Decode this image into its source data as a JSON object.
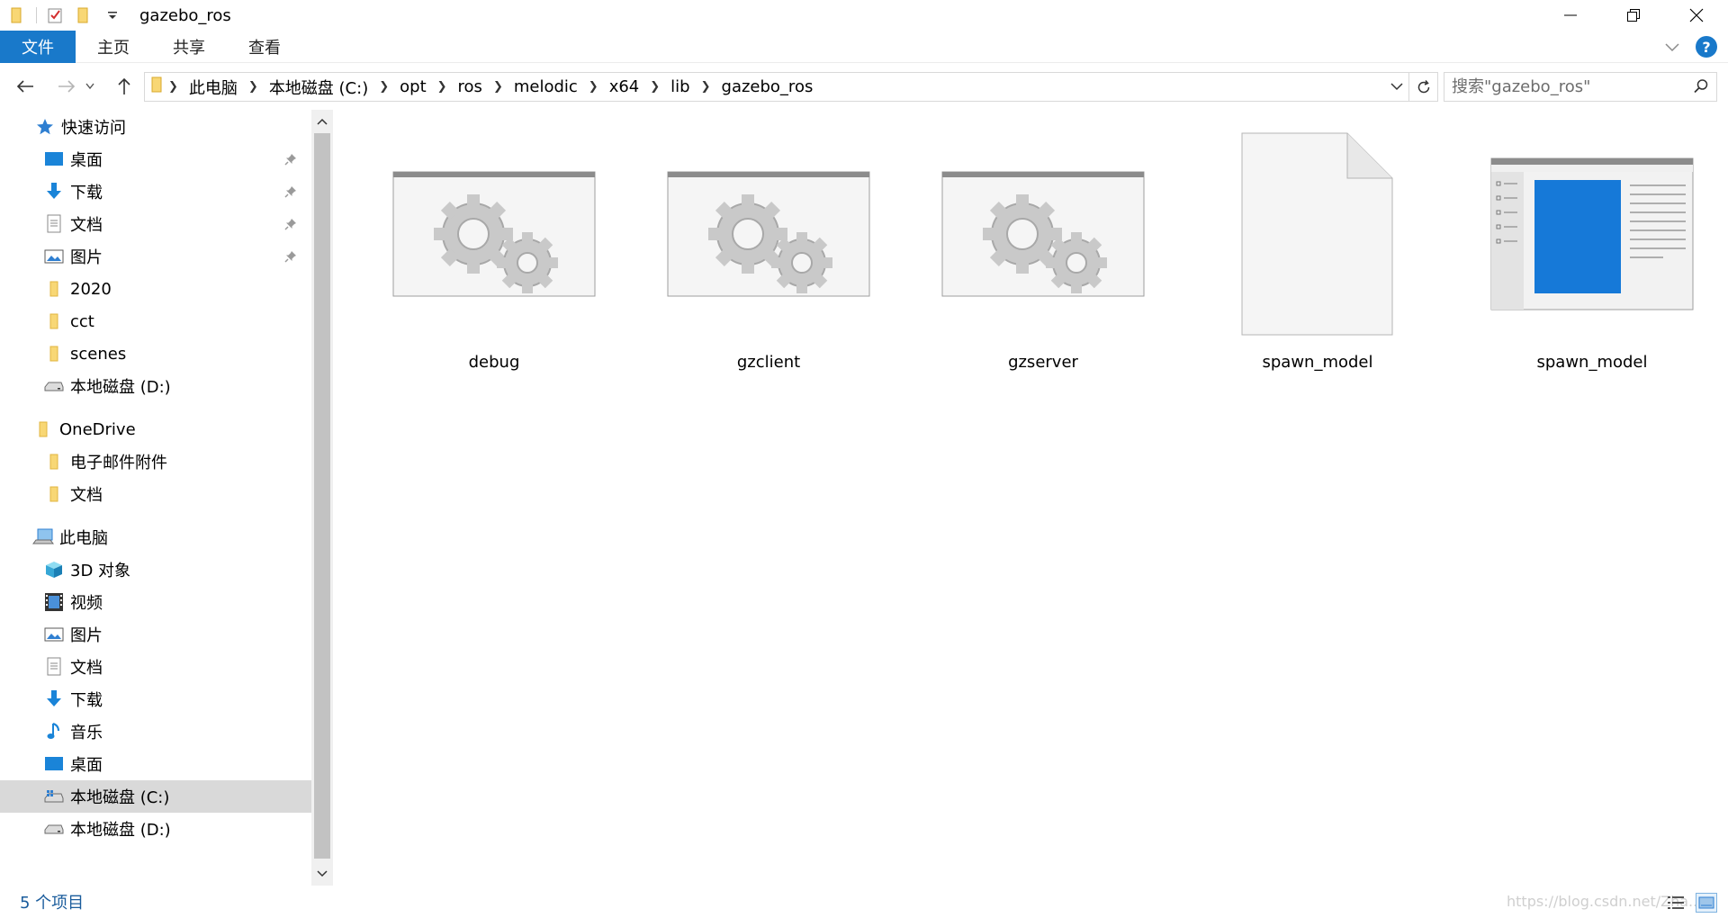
{
  "window": {
    "title": "gazebo_ros"
  },
  "ribbon": {
    "tabs": [
      "文件",
      "主页",
      "共享",
      "查看"
    ]
  },
  "address": {
    "crumbs": [
      "此电脑",
      "本地磁盘 (C:)",
      "opt",
      "ros",
      "melodic",
      "x64",
      "lib",
      "gazebo_ros"
    ]
  },
  "search": {
    "placeholder": "搜索\"gazebo_ros\""
  },
  "sidebar": {
    "quick_access": "快速访问",
    "quick_items": [
      "桌面",
      "下载",
      "文档",
      "图片",
      "2020",
      "cct",
      "scenes",
      "本地磁盘 (D:)"
    ],
    "onedrive": "OneDrive",
    "onedrive_items": [
      "电子邮件附件",
      "文档"
    ],
    "this_pc": "此电脑",
    "pc_items": [
      "3D 对象",
      "视频",
      "图片",
      "文档",
      "下载",
      "音乐",
      "桌面",
      "本地磁盘 (C:)",
      "本地磁盘 (D:)"
    ]
  },
  "files": [
    {
      "name": "debug",
      "icon": "executable-gears-icon"
    },
    {
      "name": "gzclient",
      "icon": "executable-gears-icon"
    },
    {
      "name": "gzserver",
      "icon": "executable-gears-icon"
    },
    {
      "name": "spawn_model",
      "icon": "blank-file-icon"
    },
    {
      "name": "spawn_model",
      "icon": "window-app-icon"
    }
  ],
  "status": {
    "count_text": "5 个项目",
    "watermark": "https://blog.csdn.net/Zha..."
  },
  "colors": {
    "accent": "#1979ca",
    "selected_bg": "#d9d9d9",
    "folder": "#f8d775"
  }
}
